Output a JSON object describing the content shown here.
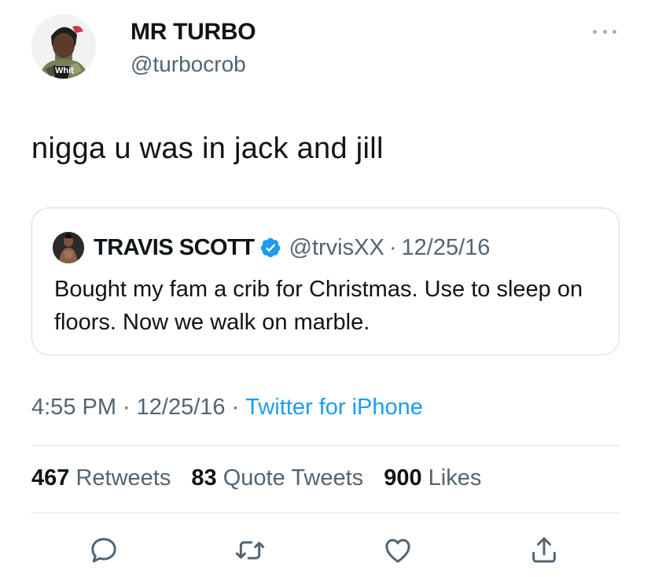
{
  "tweet": {
    "author": {
      "name": "MR TURBO",
      "handle": "@turbocrob",
      "avatar_text": "Whit"
    },
    "more_icon": "more-horizontal-icon",
    "text": "nigga u was in jack and jill",
    "quoted": {
      "name": "TRAVIS SCOTT",
      "verified": true,
      "handle": "@trvisXX",
      "separator": "·",
      "date": "12/25/16",
      "text": "Bought my fam a crib for Christmas. Use to sleep on floors. Now we walk on marble."
    },
    "meta": {
      "time": "4:55 PM",
      "separator": "·",
      "date": "12/25/16",
      "source": "Twitter for iPhone"
    },
    "stats": {
      "retweets": {
        "count": "467",
        "label": "Retweets"
      },
      "quotes": {
        "count": "83",
        "label": "Quote Tweets"
      },
      "likes": {
        "count": "900",
        "label": "Likes"
      }
    },
    "actions": [
      "reply-icon",
      "retweet-icon",
      "like-icon",
      "share-icon"
    ],
    "colors": {
      "link": "#1d9bf0",
      "secondary_text": "#536471",
      "border": "#cfd9de",
      "verified": "#1d9bf0"
    }
  }
}
